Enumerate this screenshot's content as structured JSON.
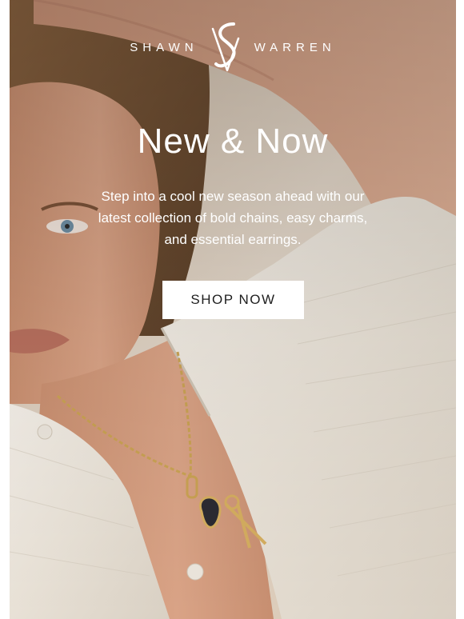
{
  "brand": {
    "name_left": "SHAWN",
    "name_right": "WARREN",
    "monogram_icon": "sw-monogram-icon"
  },
  "hero": {
    "headline": "New & Now",
    "body": "Step into a cool new season ahead with our latest collection of bold chains, easy charms, and essential earrings.",
    "cta_label": "SHOP NOW",
    "image_subject": "woman-in-white-knit-shirt-wearing-gold-charm-necklace"
  },
  "colors": {
    "text_on_image": "#ffffff",
    "button_bg": "#ffffff",
    "button_text": "#1e1e1e",
    "page_bg": "#ffffff"
  }
}
